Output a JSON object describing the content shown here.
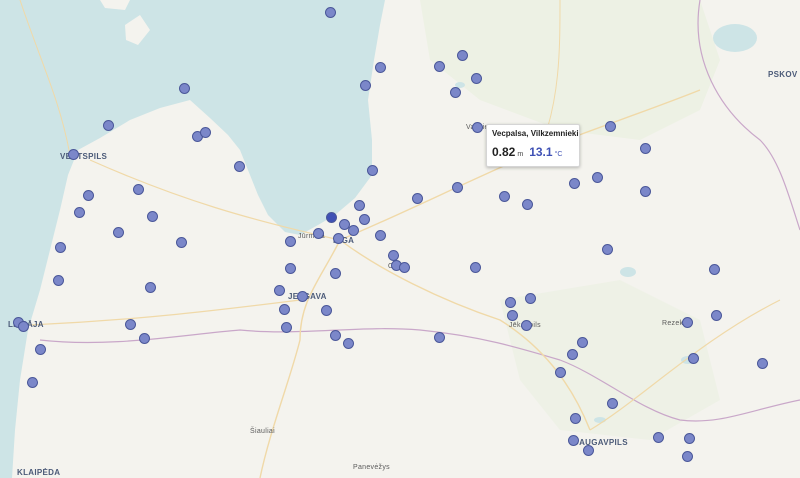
{
  "map": {
    "cities": [
      {
        "key": "ventspils",
        "label": "VENTSPILS",
        "size": "major"
      },
      {
        "key": "liepaja",
        "label": "LIEPĀJA",
        "size": "major"
      },
      {
        "key": "riga",
        "label": "RIGA",
        "size": "major"
      },
      {
        "key": "jelgava",
        "label": "JELGAVA",
        "size": "major"
      },
      {
        "key": "daugavpils",
        "label": "DAUGAVPILS",
        "size": "major"
      },
      {
        "key": "klaipeda",
        "label": "KLAIPĖDA",
        "size": "major"
      },
      {
        "key": "pskov",
        "label": "PSKOV",
        "size": "major"
      },
      {
        "key": "jurmala",
        "label": "Jūrmala",
        "size": "minor"
      },
      {
        "key": "ogre",
        "label": "Ogre",
        "size": "minor"
      },
      {
        "key": "valmiera",
        "label": "Valmiera",
        "size": "minor"
      },
      {
        "key": "jekabpils",
        "label": "Jēkabpils",
        "size": "minor"
      },
      {
        "key": "rezekne",
        "label": "Rezekne",
        "size": "minor"
      },
      {
        "key": "siauliai",
        "label": "Šiauliai",
        "size": "minor"
      },
      {
        "key": "panevezys",
        "label": "Panevėžys",
        "size": "minor"
      }
    ],
    "colors": {
      "station_fill": "#7b87c9",
      "station_stroke": "#4a5799",
      "sea": "#cde4e6",
      "land": "#f4f3ee",
      "temp_accent": "#3f51b5"
    }
  },
  "tooltip": {
    "station_name": "Vecpalsa, Vilkzemnieki",
    "water_level": "0.82",
    "water_level_unit": "m",
    "temperature": "13.1",
    "temperature_unit": "°C"
  }
}
